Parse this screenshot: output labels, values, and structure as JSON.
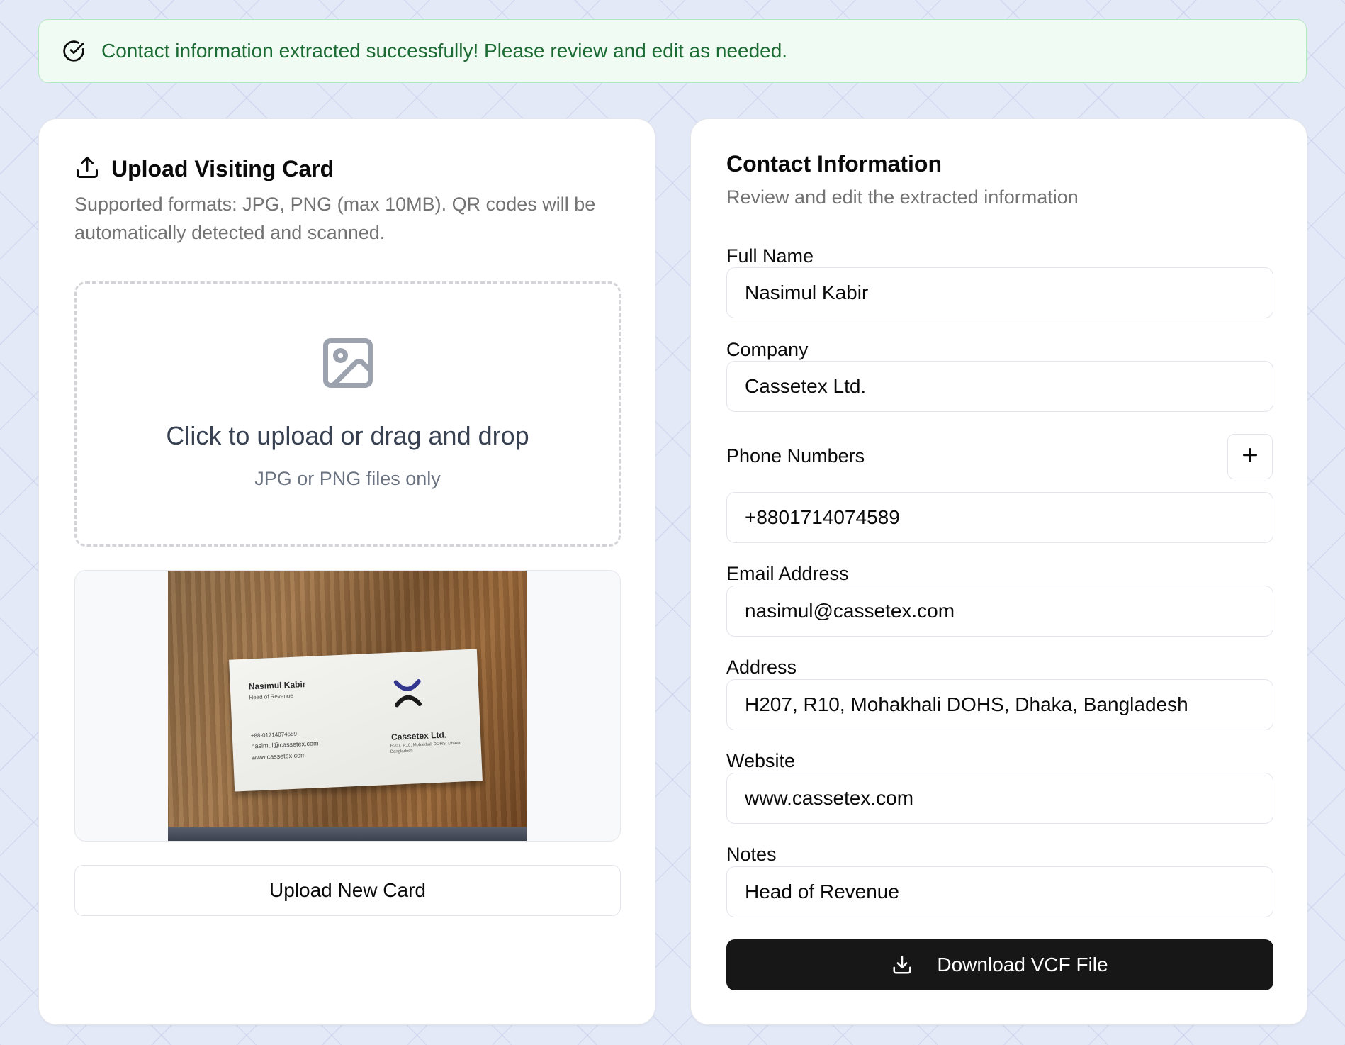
{
  "banner": {
    "message": "Contact information extracted successfully! Please review and edit as needed.",
    "icon": "check-circle-icon",
    "color": "#1d6b34"
  },
  "upload": {
    "title": "Upload Visiting Card",
    "title_icon": "upload-icon",
    "description": "Supported formats: JPG, PNG (max 10MB). QR codes will be automatically detected and scanned.",
    "dropzone": {
      "icon": "image-icon",
      "title": "Click to upload or drag and drop",
      "subtitle": "JPG or PNG files only"
    },
    "preview_card": {
      "name": "Nasimul Kabir",
      "role": "Head of Revenue",
      "phone": "+88-01714074589",
      "email": "nasimul@cassetex.com",
      "website": "www.cassetex.com",
      "company": "Cassetex Ltd.",
      "address": "H207, R10, Mohakhali DOHS, Dhaka, Bangladesh"
    },
    "upload_new_label": "Upload New Card"
  },
  "contact": {
    "title": "Contact Information",
    "description": "Review and edit the extracted information",
    "fields": {
      "full_name": {
        "label": "Full Name",
        "value": "Nasimul Kabir"
      },
      "company": {
        "label": "Company",
        "value": "Cassetex Ltd."
      },
      "phone": {
        "label": "Phone Numbers",
        "value": "+8801714074589",
        "add_icon": "plus-icon"
      },
      "email": {
        "label": "Email Address",
        "value": "nasimul@cassetex.com"
      },
      "address": {
        "label": "Address",
        "value": "H207, R10, Mohakhali DOHS, Dhaka, Bangladesh"
      },
      "website": {
        "label": "Website",
        "value": "www.cassetex.com"
      },
      "notes": {
        "label": "Notes",
        "value": "Head of Revenue"
      }
    },
    "download_label": "Download VCF File",
    "download_icon": "download-icon"
  },
  "colors": {
    "primary_button": "#171717",
    "success_bg": "#f0fbf3",
    "success_border": "#b7e6c4",
    "muted_text": "#737373"
  }
}
